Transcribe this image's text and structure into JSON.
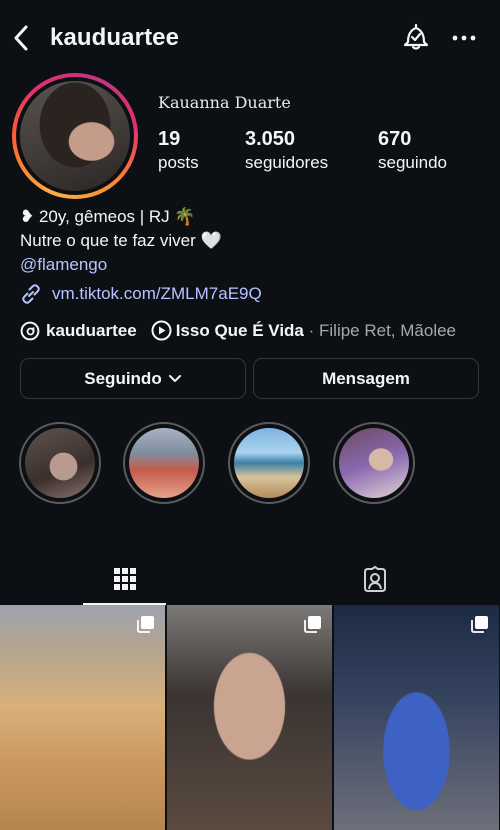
{
  "header": {
    "username": "kauduartee"
  },
  "profile": {
    "full_name": "Kauanna Duarte",
    "stats": [
      {
        "value": "19",
        "label": "posts"
      },
      {
        "value": "3.050",
        "label": "seguidores"
      },
      {
        "value": "670",
        "label": "seguindo"
      }
    ],
    "bio": {
      "line1": "❥ 20y, gêmeos | RJ 🌴",
      "line2": "Nutre o que te faz viver 🤍",
      "line3": "@flamengo"
    },
    "link": "vm.tiktok.com/ZMLM7aE9Q",
    "threads_handle": "kauduartee",
    "music": {
      "song": "Isso Que É Vida",
      "separator": " · ",
      "artist": "Filipe Ret, Mãolee"
    }
  },
  "buttons": {
    "following": "Seguindo",
    "message": "Mensagem"
  },
  "tabs": [
    {
      "icon": "grid-icon"
    },
    {
      "icon": "tagged-person-icon"
    }
  ],
  "highlights_count": 4,
  "posts_visible": 3
}
